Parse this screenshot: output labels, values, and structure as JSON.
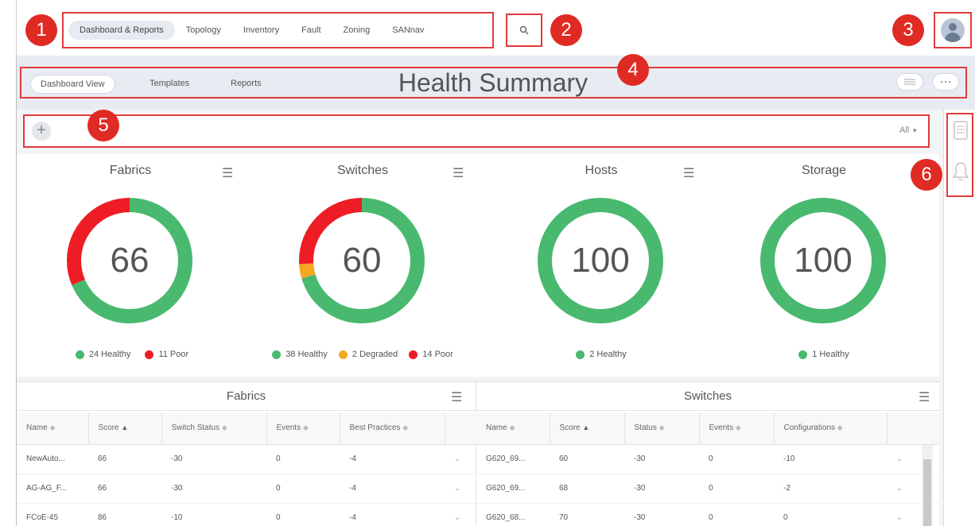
{
  "topnav": {
    "items": [
      {
        "label": "Dashboard & Reports",
        "active": true
      },
      {
        "label": "Topology",
        "active": false
      },
      {
        "label": "Inventory",
        "active": false
      },
      {
        "label": "Fault",
        "active": false
      },
      {
        "label": "Zoning",
        "active": false
      },
      {
        "label": "SANnav",
        "active": false
      }
    ],
    "search_icon": "search-icon",
    "avatar_icon": "user-avatar-icon"
  },
  "callouts": [
    "1",
    "2",
    "3",
    "4",
    "5",
    "6"
  ],
  "subnav": {
    "tabs": [
      {
        "label": "Dashboard View",
        "active": true
      },
      {
        "label": "Templates",
        "active": false
      },
      {
        "label": "Reports",
        "active": false
      }
    ],
    "title": "Health Summary",
    "list_icon": "list-view-icon",
    "more_icon": "more-icon"
  },
  "toolbar": {
    "add_label": "+",
    "filter_label": "All",
    "filter_icon": "caret-down-icon"
  },
  "rail": {
    "icons": [
      "report-icon",
      "bell-icon"
    ]
  },
  "colors": {
    "healthy": "#48b96e",
    "poor": "#ee1c24",
    "degraded": "#f5a623",
    "callout": "#e02a24"
  },
  "health": [
    {
      "title": "Fabrics",
      "score": "66",
      "segments": [
        {
          "status": "healthy",
          "count": 24
        },
        {
          "status": "poor",
          "count": 11
        }
      ],
      "legend": [
        "24 Healthy",
        "11 Poor"
      ]
    },
    {
      "title": "Switches",
      "score": "60",
      "segments": [
        {
          "status": "healthy",
          "count": 38
        },
        {
          "status": "degraded",
          "count": 2
        },
        {
          "status": "poor",
          "count": 14
        }
      ],
      "legend": [
        "38 Healthy",
        "2 Degraded",
        "14 Poor"
      ]
    },
    {
      "title": "Hosts",
      "score": "100",
      "segments": [
        {
          "status": "healthy",
          "count": 2
        }
      ],
      "legend": [
        "2 Healthy"
      ]
    },
    {
      "title": "Storage",
      "score": "100",
      "segments": [
        {
          "status": "healthy",
          "count": 1
        }
      ],
      "legend": [
        "1 Healthy"
      ]
    }
  ],
  "tables": {
    "fabrics": {
      "title": "Fabrics",
      "columns": [
        "Name",
        "Score",
        "Switch Status",
        "Events",
        "Best Practices"
      ],
      "rows": [
        [
          "NewAuto...",
          "66",
          "-30",
          "0",
          "-4"
        ],
        [
          "AG-AG_F...",
          "66",
          "-30",
          "0",
          "-4"
        ],
        [
          "FCoE-45",
          "86",
          "-10",
          "0",
          "-4"
        ]
      ]
    },
    "switches": {
      "title": "Switches",
      "columns": [
        "Name",
        "Score",
        "Status",
        "Events",
        "Configurations"
      ],
      "rows": [
        [
          "G620_69...",
          "60",
          "-30",
          "0",
          "-10"
        ],
        [
          "G620_69...",
          "68",
          "-30",
          "0",
          "-2"
        ],
        [
          "G620_68...",
          "70",
          "-30",
          "0",
          "0"
        ]
      ]
    }
  }
}
